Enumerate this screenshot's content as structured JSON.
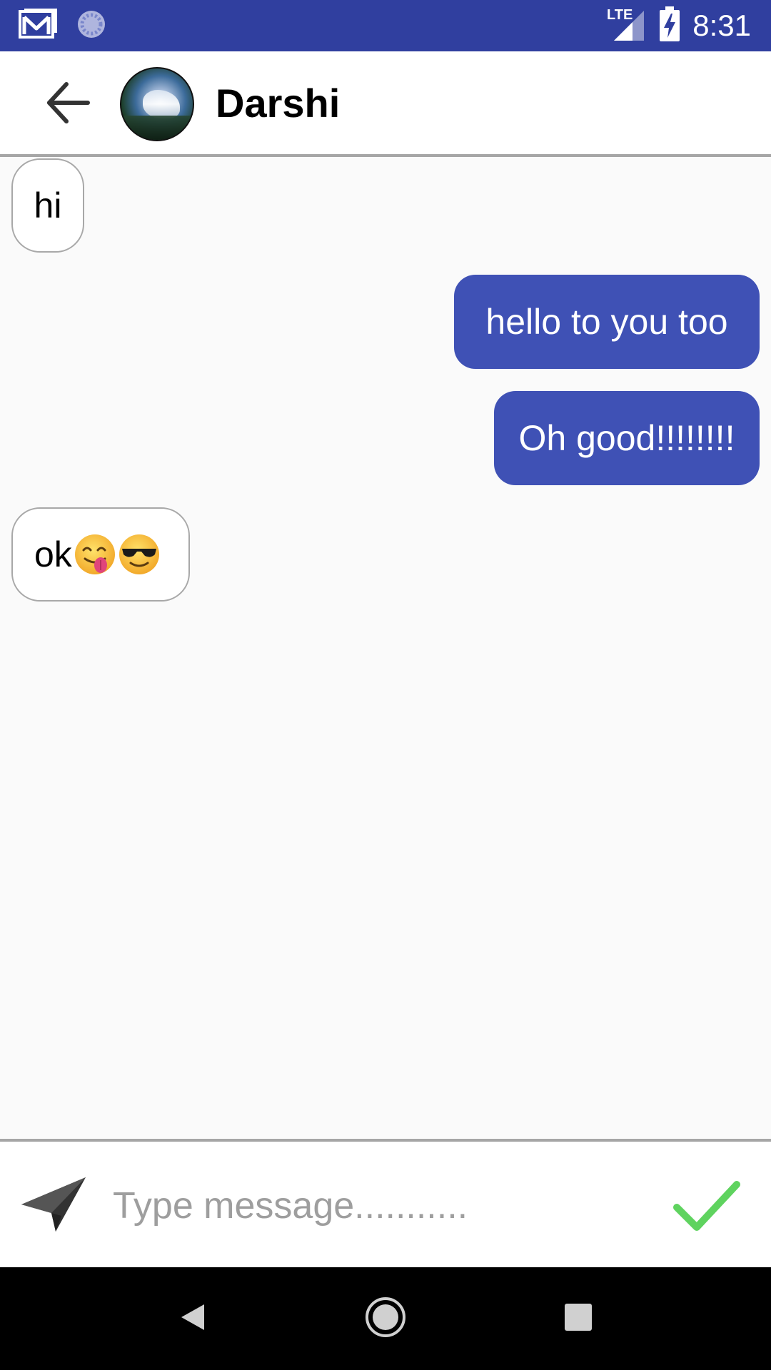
{
  "status_bar": {
    "time": "8:31",
    "network_label": "LTE",
    "icons": [
      "gmail-icon",
      "sync-icon",
      "lte-signal-icon",
      "battery-charging-icon"
    ],
    "color": "#303f9f"
  },
  "header": {
    "contact_name": "Darshi",
    "back_icon": "arrow-back-icon",
    "avatar_icon": "contact-avatar"
  },
  "messages": [
    {
      "direction": "incoming",
      "text": "hi"
    },
    {
      "direction": "outgoing",
      "text": "hello to you too"
    },
    {
      "direction": "outgoing",
      "text": "Oh good!!!!!!!!"
    },
    {
      "direction": "incoming",
      "text": "ok",
      "emojis": [
        "yum-face-emoji",
        "sunglasses-face-emoji"
      ]
    }
  ],
  "composer": {
    "placeholder": "Type message...........",
    "value": "",
    "attach_icon": "paper-plane-icon",
    "send_icon": "checkmark-icon"
  },
  "nav_bar": {
    "icons": [
      "nav-back-icon",
      "nav-home-icon",
      "nav-recents-icon"
    ]
  },
  "colors": {
    "primary_dark": "#303f9f",
    "outgoing_bubble": "#3f51b5",
    "incoming_bubble_border": "#a8a8a8",
    "send_check": "#5fd35f",
    "background": "#fafafa"
  }
}
